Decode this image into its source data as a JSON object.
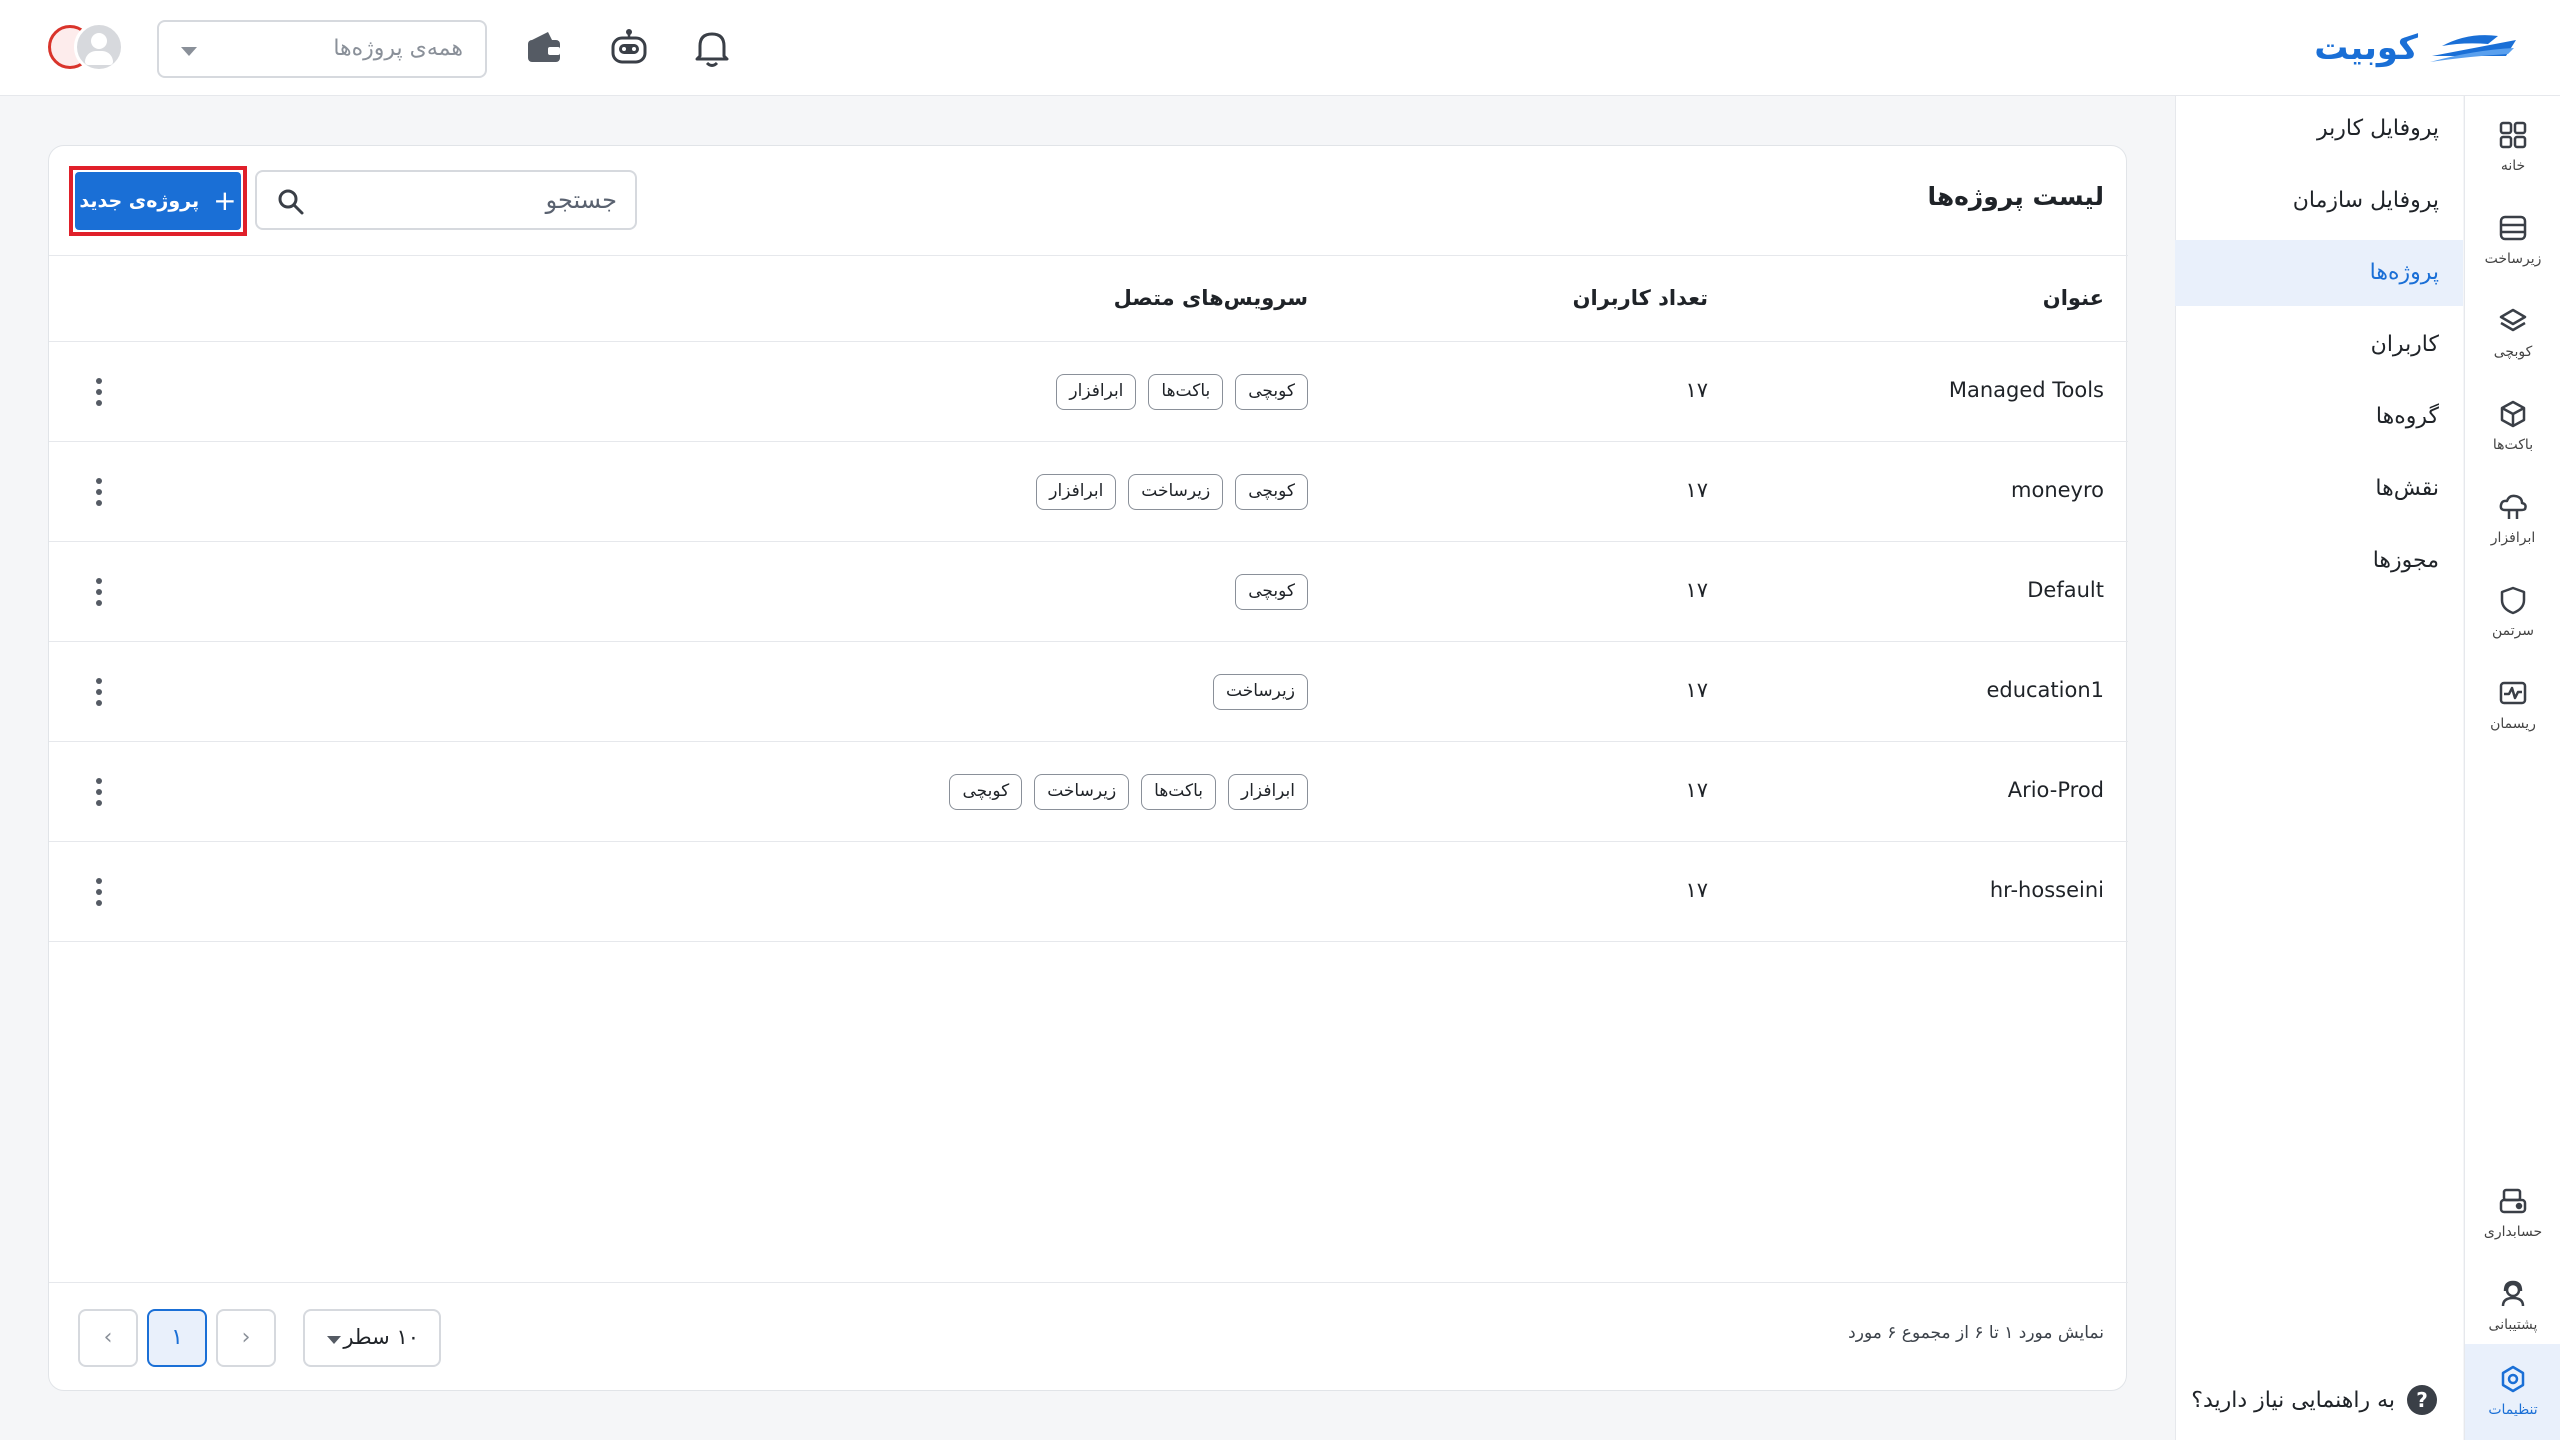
{
  "brand": {
    "name": "کوبیت",
    "color": "#1a6fd6"
  },
  "topbar": {
    "project_select_placeholder": "همه‌ی پروژه‌ها",
    "icons": [
      "wallet-icon",
      "robot-icon",
      "bell-icon"
    ]
  },
  "rail": {
    "items": [
      {
        "label": "خانه",
        "icon": "grid-icon"
      },
      {
        "label": "زیرساخت",
        "icon": "server-icon"
      },
      {
        "label": "کوبچی",
        "icon": "layers-icon"
      },
      {
        "label": "باکت‌ها",
        "icon": "cube-icon"
      },
      {
        "label": "ابرافزار",
        "icon": "cloud-icon"
      },
      {
        "label": "سرتمن",
        "icon": "shield-icon"
      },
      {
        "label": "ریسمان",
        "icon": "monitor-wave-icon"
      }
    ],
    "bottom": [
      {
        "label": "حسابداری",
        "icon": "accounting-icon"
      },
      {
        "label": "پشتیبانی",
        "icon": "support-icon"
      },
      {
        "label": "تنظیمات",
        "icon": "settings-icon"
      }
    ]
  },
  "submenu": {
    "items": [
      "پروفایل کاربر",
      "پروفایل سازمان",
      "پروژه‌ها",
      "کاربران",
      "گروه‌ها",
      "نقش‌ها",
      "مجوزها"
    ],
    "active_index": 2,
    "help": "به راهنمایی نیاز دارید؟"
  },
  "projects": {
    "title": "لیست پروژه‌ها",
    "search_placeholder": "جستجو",
    "new_button": "پروژه‌ی جدید",
    "columns": {
      "title": "عنوان",
      "users": "تعداد کاربران",
      "services": "سرویس‌های متصل"
    },
    "rows": [
      {
        "title": "Managed Tools",
        "users": "۱۷",
        "services": [
          "کوبچی",
          "باکت‌ها",
          "ابرافزار"
        ]
      },
      {
        "title": "moneyro",
        "users": "۱۷",
        "services": [
          "کوبچی",
          "زیرساخت",
          "ابرافزار"
        ]
      },
      {
        "title": "Default",
        "users": "۱۷",
        "services": [
          "کوبچی"
        ]
      },
      {
        "title": "education1",
        "users": "۱۷",
        "services": [
          "زیرساخت"
        ]
      },
      {
        "title": "Ario-Prod",
        "users": "۱۷",
        "services": [
          "ابرافزار",
          "باکت‌ها",
          "زیرساخت",
          "کوبچی"
        ]
      },
      {
        "title": "hr-hosseini",
        "users": "۱۷",
        "services": []
      }
    ],
    "footer": {
      "summary": "نمایش مورد ۱ تا ۶ از مجموع ۶ مورد",
      "rows_per_page": "۱۰ سطر",
      "current_page": "۱"
    }
  }
}
